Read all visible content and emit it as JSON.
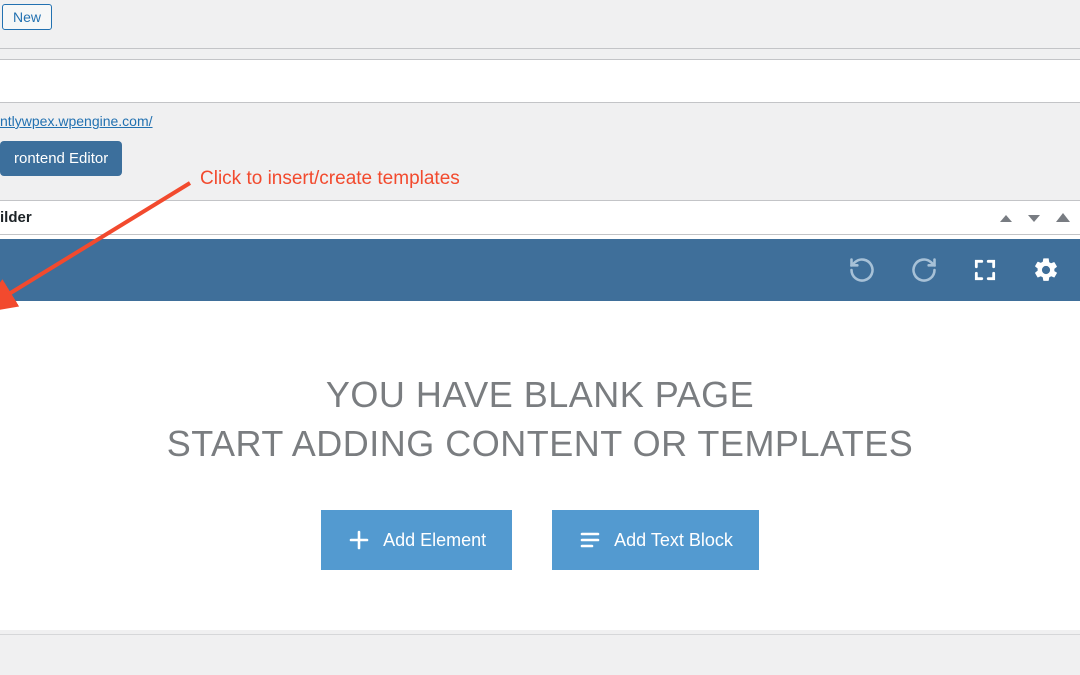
{
  "top": {
    "new_button": "New"
  },
  "permalink": {
    "url_text": "ntlywpex.wpengine.com/"
  },
  "editor": {
    "frontend_button": "rontend Editor"
  },
  "annotation": {
    "text": "Click to insert/create templates"
  },
  "panel": {
    "title": "ilder"
  },
  "content": {
    "line1": "YOU HAVE BLANK PAGE",
    "line2": "START ADDING CONTENT OR TEMPLATES",
    "add_element": "Add Element",
    "add_text_block": "Add Text Block"
  }
}
